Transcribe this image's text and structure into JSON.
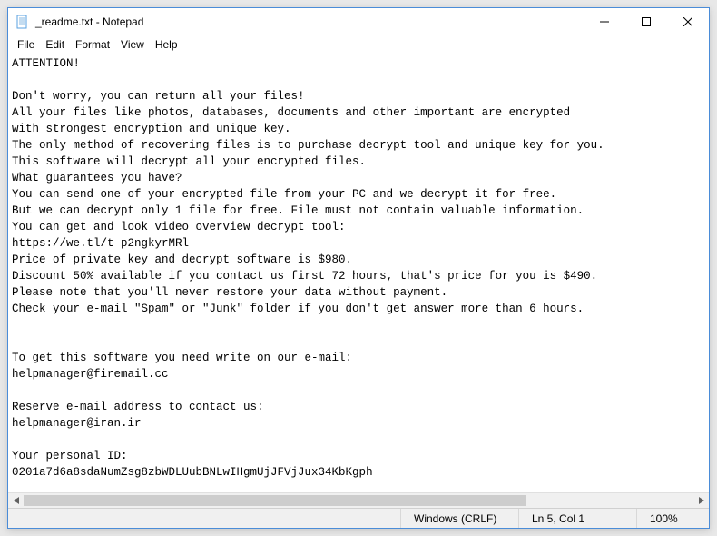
{
  "titlebar": {
    "title": "_readme.txt - Notepad"
  },
  "menu": {
    "file": "File",
    "edit": "Edit",
    "format": "Format",
    "view": "View",
    "help": "Help"
  },
  "editor": {
    "lines": [
      "ATTENTION!",
      "",
      "Don't worry, you can return all your files!",
      "All your files like photos, databases, documents and other important are encrypted",
      "with strongest encryption and unique key.",
      "The only method of recovering files is to purchase decrypt tool and unique key for you.",
      "This software will decrypt all your encrypted files.",
      "What guarantees you have?",
      "You can send one of your encrypted file from your PC and we decrypt it for free.",
      "But we can decrypt only 1 file for free. File must not contain valuable information.",
      "You can get and look video overview decrypt tool:",
      "https://we.tl/t-p2ngkyrMRl",
      "Price of private key and decrypt software is $980.",
      "Discount 50% available if you contact us first 72 hours, that's price for you is $490.",
      "Please note that you'll never restore your data without payment.",
      "Check your e-mail \"Spam\" or \"Junk\" folder if you don't get answer more than 6 hours.",
      "",
      "",
      "To get this software you need write on our e-mail:",
      "helpmanager@firemail.cc",
      "",
      "Reserve e-mail address to contact us:",
      "helpmanager@iran.ir",
      "",
      "Your personal ID:",
      "0201a7d6a8sdaNumZsg8zbWDLUubBNLwIHgmUjJFVjJux34KbKgph"
    ]
  },
  "statusbar": {
    "line_ending": "Windows (CRLF)",
    "cursor": "Ln 5, Col 1",
    "zoom": "100%"
  }
}
